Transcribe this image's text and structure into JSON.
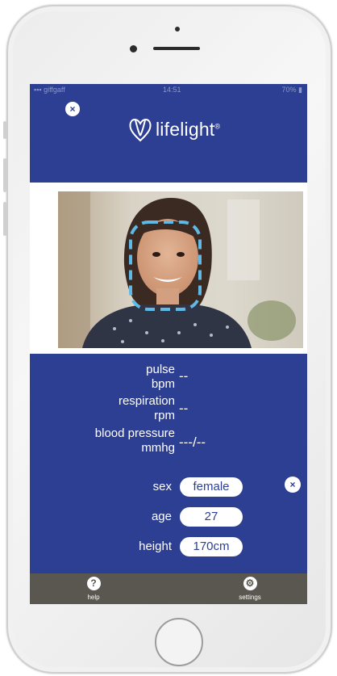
{
  "status_bar": {
    "carrier": "giffgaff",
    "time": "14:51",
    "battery": "70%"
  },
  "header": {
    "close_label": "×",
    "logo_text": "lifelight",
    "logo_mark": "®"
  },
  "photo": {
    "alt": "woman-face-with-detection-box"
  },
  "vitals": {
    "pulse_label_1": "pulse",
    "pulse_label_2": "bpm",
    "pulse_value": "--",
    "resp_label_1": "respiration",
    "resp_label_2": "rpm",
    "resp_value": "--",
    "bp_label_1": "blood pressure",
    "bp_label_2": "mmhg",
    "bp_value": "---/--"
  },
  "form": {
    "sex_label": "sex",
    "sex_value": "female",
    "age_label": "age",
    "age_value": "27",
    "height_label": "height",
    "height_value": "170cm",
    "close_label": "×"
  },
  "bottom_bar": {
    "help_icon": "?",
    "help_label": "help",
    "settings_icon": "gear-icon",
    "settings_label": "settings"
  },
  "colors": {
    "brand_blue": "#2d3f93",
    "bottom_bar": "#5a5650",
    "face_box": "#5fb8e6"
  }
}
